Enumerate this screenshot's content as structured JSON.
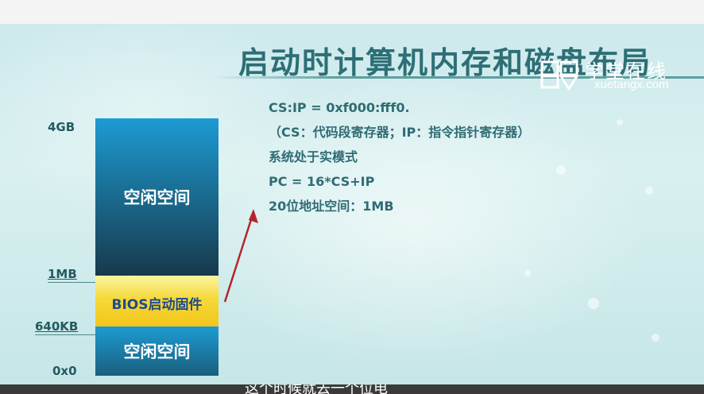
{
  "slide": {
    "title": "启动时计算机内存和磁盘布局"
  },
  "logo": {
    "chinese": "学堂在线",
    "domain": "xuetangx.com"
  },
  "memory_map": {
    "segments": [
      {
        "label": "空闲空间"
      },
      {
        "label": "BIOS启动固件"
      },
      {
        "label": "空闲空间"
      }
    ],
    "addresses": [
      "4GB",
      "1MB",
      "640KB",
      "0x0"
    ]
  },
  "notes": [
    "CS:IP = 0xf000:fff0.",
    "（CS：代码段寄存器；IP：指令指针寄存器）",
    "系统处于实模式",
    "PC = 16*CS+IP",
    "20位地址空间：1MB"
  ],
  "subtitle": "这个时候就去一个位电",
  "colors": {
    "title": "#2d6f76",
    "segment_blue": "#1c7fae",
    "segment_yellow": "#f5d93a",
    "arrow": "#b3262b",
    "subtitle_bar": "#3a3a3a"
  }
}
